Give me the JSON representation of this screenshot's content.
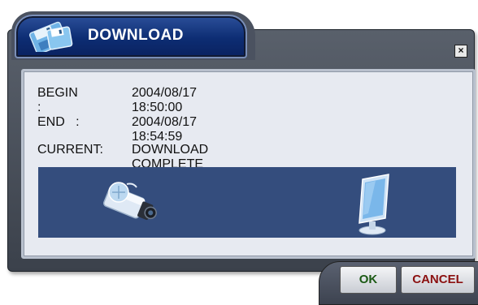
{
  "window": {
    "title": "DOWNLOAD",
    "close_label": "×"
  },
  "fields": {
    "begin_label": "BEGIN :",
    "begin_value": "2004/08/17 18:50:00",
    "end_label": "END   :",
    "end_value": "2004/08/17 18:54:59",
    "current_label": "CURRENT:",
    "current_value": "DOWNLOAD COMPLETE"
  },
  "buttons": {
    "ok_label": "OK",
    "cancel_label": "CANCEL"
  },
  "icons": {
    "title": "download-disk-icon",
    "source": "camera-icon",
    "destination": "monitor-icon"
  },
  "colors": {
    "title_bg": "#0d2d73",
    "transfer_bg": "#344d7d",
    "ok_text": "#1b5a14",
    "cancel_text": "#8b1010"
  }
}
